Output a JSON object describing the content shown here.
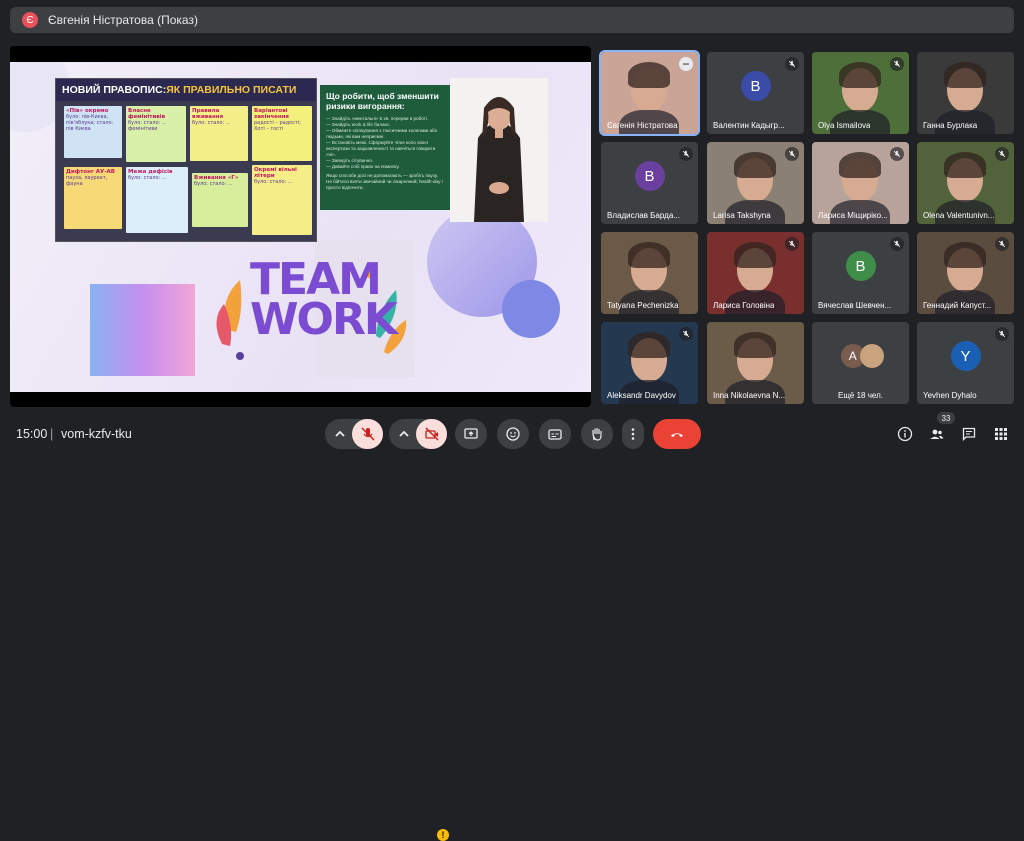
{
  "header": {
    "avatar_letter": "Є",
    "title": "Євгенія Ністратова (Показ)"
  },
  "slide": {
    "rules_title_a": "НОВИЙ ПРАВОПИС:",
    "rules_title_b": " ЯК ПРАВИЛЬНО ПИСАТИ",
    "stickies": [
      {
        "title": "«Пів» окремо",
        "text": "було: пів-Києва, пів'яблука; стало: пів Києва"
      },
      {
        "title": "Власне фемінітивів",
        "text": "було: стало: ... фемінітиви"
      },
      {
        "title": "Правила вживання",
        "text": "було: стало: ..."
      },
      {
        "title": "Варіантові закінчення",
        "text": "радості – радості; Хоті – гості"
      },
      {
        "title": "Дифтонг АУ-АВ",
        "text": "пауза, лауреат, фауна"
      },
      {
        "title": "Межа дефісів",
        "text": "було: стало: ..."
      },
      {
        "title": "Вживання «Г»",
        "text": "було: стало: ..."
      },
      {
        "title": "Окремі вільні літери",
        "text": "було: стало: ..."
      }
    ],
    "green_title": "Що робити, щоб зменшити ризики вигорання:",
    "green_lines": [
      "— Знайдіть «ментальні» 5 хв. перерви в роботі.",
      "— Знайдіть work & life баланс.",
      "— Обмежте спілкування з токсичними колегами або людьми, які вам неприємні.",
      "— Встановіть межі. Сформуйте чітке коло своєї експертизи та зацікавленості та навчіться говорити «ні».",
      "— Заведіть сітування.",
      "— Давайте собі право на помилку.",
      "Якщо способи досі не допомагають — зробіть паузу. Не бійтеся взяти звичайний чи лікарняний; health-day і просто відпочити."
    ],
    "teamwork": "TEAM WORK"
  },
  "participants": [
    {
      "name": "Євгенія Ністратова",
      "type": "video",
      "active": true,
      "bg": "#caa597",
      "more": true
    },
    {
      "name": "Валентин Кадыгр...",
      "type": "letter",
      "letter": "В",
      "bg": "#3a4ba8",
      "muted": true
    },
    {
      "name": "Olya Ismailova",
      "type": "video",
      "bg": "#4f6f3a",
      "muted": true
    },
    {
      "name": "Ганна Бурлака",
      "type": "video",
      "bg": "#3a3a3a",
      "muted": false
    },
    {
      "name": "Владислав Барда...",
      "type": "letter",
      "letter": "В",
      "bg": "#6b3fa0",
      "muted": true
    },
    {
      "name": "Larisa Takshyna",
      "type": "video",
      "bg": "#8a8073",
      "muted": true
    },
    {
      "name": "Лариса Міщиріко...",
      "type": "video",
      "bg": "#b8a39a",
      "muted": true
    },
    {
      "name": "Olena Valentunivn...",
      "type": "video",
      "bg": "#52623a",
      "muted": true
    },
    {
      "name": "Tatyana Pechenizka",
      "type": "video",
      "bg": "#6b5a47",
      "muted": false
    },
    {
      "name": "Лариса Головіна",
      "type": "video",
      "bg": "#7a2f2f",
      "muted": true
    },
    {
      "name": "Вячеслав Шевчен...",
      "type": "letter",
      "letter": "В",
      "bg": "#3e8e4a",
      "muted": true
    },
    {
      "name": "Геннадий Капуст...",
      "type": "video",
      "bg": "#5a4d40",
      "muted": true
    },
    {
      "name": "Aleksandr Davydov",
      "type": "video",
      "bg": "#24384f",
      "muted": true
    },
    {
      "name": "Inna Nikolaevna N...",
      "type": "video",
      "bg": "#6a5c48",
      "muted": false
    },
    {
      "name": "Ещё 18 чел.",
      "type": "more",
      "letter": "А",
      "bg": "#3c4043"
    },
    {
      "name": "Yevhen Dyhalo",
      "type": "letter",
      "letter": "Y",
      "bg": "#1a5fb4",
      "muted": true
    }
  ],
  "footer": {
    "time": "15:00",
    "separator": "|",
    "meeting_code": "vom-kzfv-tku",
    "people_count": "33",
    "warning": "!"
  }
}
